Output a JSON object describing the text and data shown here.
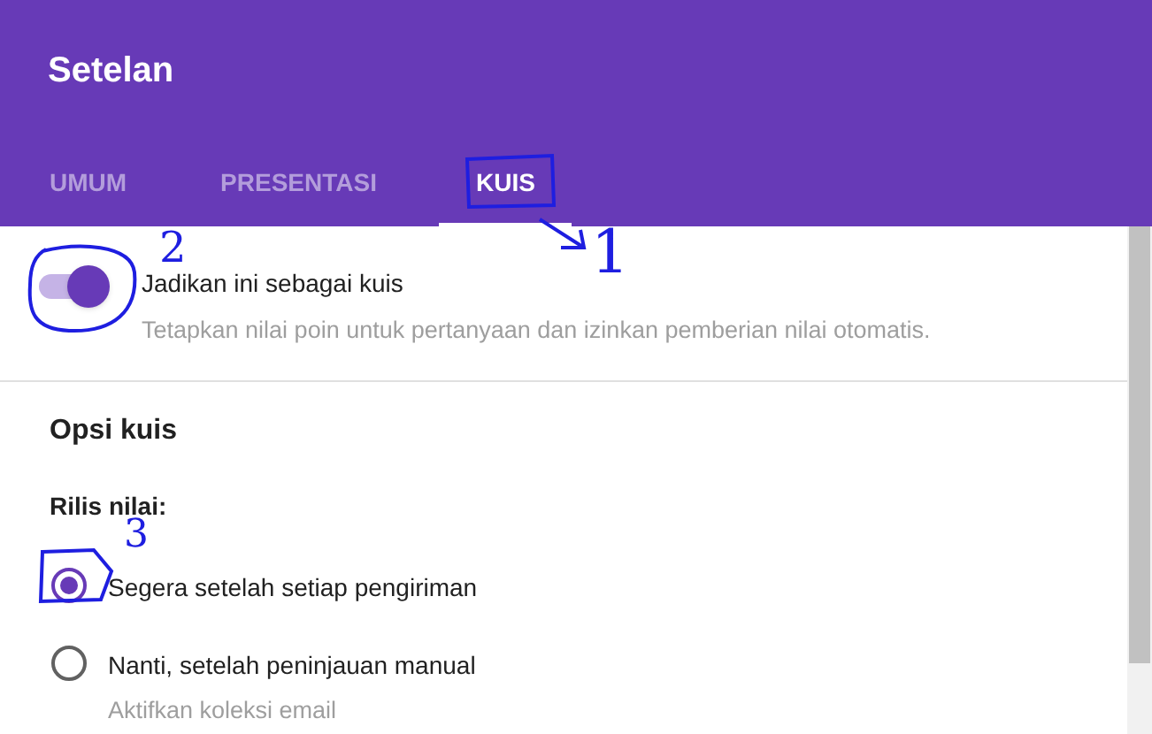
{
  "window": {
    "title": "Setelan"
  },
  "tabs": [
    {
      "label": "UMUM",
      "selected": false
    },
    {
      "label": "PRESENTASI",
      "selected": false
    },
    {
      "label": "KUIS",
      "selected": true
    }
  ],
  "quiz_toggle": {
    "label": "Jadikan ini sebagai kuis",
    "description": "Tetapkan nilai poin untuk pertanyaan dan izinkan pemberian nilai otomatis.",
    "on": true
  },
  "section": {
    "title": "Opsi kuis",
    "release_label": "Rilis nilai:"
  },
  "release_options": [
    {
      "label": "Segera setelah setiap pengiriman",
      "selected": true
    },
    {
      "label": "Nanti, setelah peninjauan manual",
      "description": "Aktifkan koleksi email",
      "selected": false
    }
  ],
  "annotations": [
    {
      "label": "1"
    },
    {
      "label": "2"
    },
    {
      "label": "3"
    }
  ]
}
